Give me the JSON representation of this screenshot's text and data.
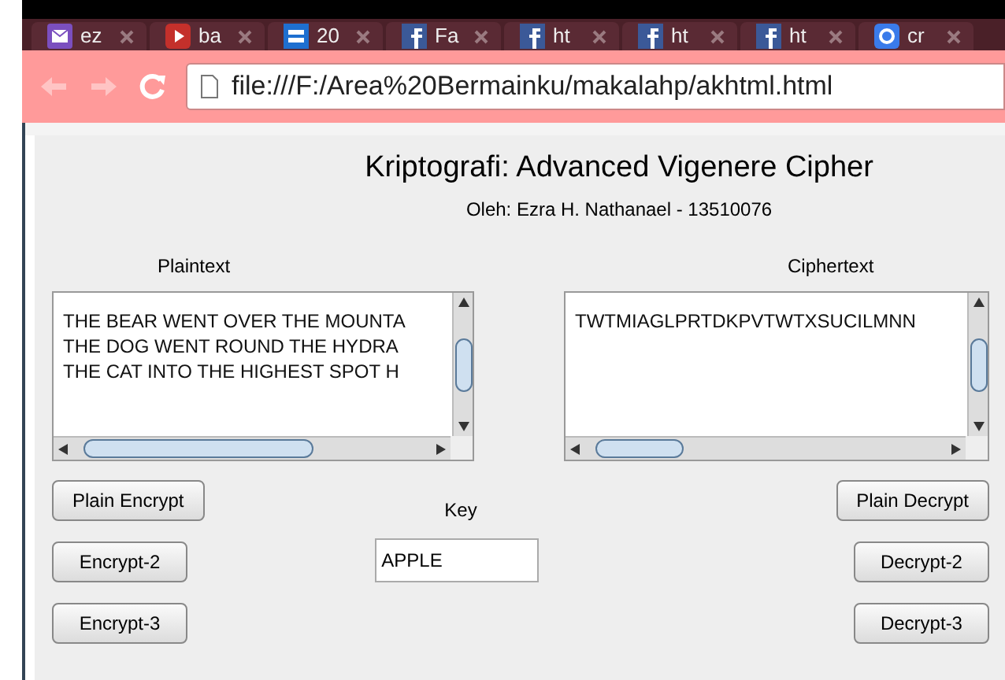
{
  "browser": {
    "tabs": [
      {
        "kind": "mail",
        "label": "ez"
      },
      {
        "kind": "video",
        "label": "ba"
      },
      {
        "kind": "news",
        "label": "20"
      },
      {
        "kind": "social",
        "label": "Fa"
      },
      {
        "kind": "social",
        "label": "ht"
      },
      {
        "kind": "social",
        "label": "ht"
      },
      {
        "kind": "social",
        "label": "ht"
      },
      {
        "kind": "search",
        "label": "cr"
      }
    ],
    "address": "file:///F:/Area%20Bermainku/makalahp/akhtml.html"
  },
  "app": {
    "title": "Kriptografi: Advanced Vigenere Cipher",
    "subtitle": "Oleh: Ezra H. Nathanael - 13510076",
    "plaintext": {
      "label": "Plaintext",
      "lines": [
        "THE BEAR WENT OVER THE MOUNTA",
        "THE DOG WENT ROUND THE HYDRA",
        "THE CAT INTO THE HIGHEST SPOT H"
      ]
    },
    "ciphertext": {
      "label": "Ciphertext",
      "lines": [
        "TWTMIAGLPRTDKPVTWTXSUCILMNN"
      ]
    },
    "key": {
      "label": "Key",
      "value": "APPLE"
    },
    "left_buttons": [
      "Plain Encrypt",
      "Encrypt-2",
      "Encrypt-3"
    ],
    "right_buttons": [
      "Plain Decrypt",
      "Decrypt-2",
      "Decrypt-3"
    ]
  }
}
